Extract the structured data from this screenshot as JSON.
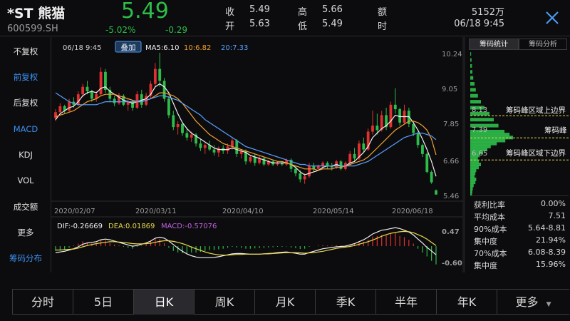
{
  "header": {
    "name": "*ST 熊猫",
    "code": "600599.SH",
    "price": "5.49",
    "change_pct": "-5.02%",
    "change_abs": "-0.29",
    "quote": [
      {
        "label": "收",
        "value": "5.49"
      },
      {
        "label": "开",
        "value": "5.63"
      },
      {
        "label": "高",
        "value": "5.66"
      },
      {
        "label": "低",
        "value": "5.49"
      },
      {
        "label": "额",
        "value": "5152万"
      },
      {
        "label": "时",
        "value": "06/18 9:45"
      }
    ]
  },
  "sidebar": {
    "items": [
      {
        "label": "不复权",
        "blue": false
      },
      {
        "label": "前复权",
        "blue": true
      },
      {
        "label": "后复权",
        "blue": false
      },
      {
        "label": "MACD",
        "blue": true
      },
      {
        "label": "KDJ",
        "blue": false
      },
      {
        "label": "VOL",
        "blue": false
      },
      {
        "label": "成交额",
        "blue": false
      },
      {
        "label": "更多",
        "blue": false
      },
      {
        "label": "筹码分布",
        "blue": true
      }
    ]
  },
  "kline": {
    "timestamp": "06/18 9:45",
    "overlay_button": "叠加",
    "ma_labels": [
      {
        "text": "MA5:6.10",
        "color": "#f0f0f0"
      },
      {
        "text": "10:6.82",
        "color": "#f0a030"
      },
      {
        "text": "20:7.33",
        "color": "#5aa0ff"
      }
    ],
    "price_ticks": [
      "10.24",
      "9.05",
      "7.85",
      "6.66",
      "5.46"
    ],
    "date_ticks": [
      "2020/02/07",
      "2020/03/11",
      "2020/04/10",
      "2020/05/14",
      "2020/06/18"
    ],
    "macd_legend": [
      {
        "text": "DIF:-0.26669",
        "color": "#f0f0f0"
      },
      {
        "text": "DEA:0.01869",
        "color": "#e8d84a"
      },
      {
        "text": "MACD:-0.57076",
        "color": "#c060e0"
      }
    ],
    "macd_ticks": [
      "0.47",
      "-0.60"
    ],
    "up_color": "#e03030",
    "down_color": "#2dbd4a"
  },
  "chip": {
    "tabs": [
      "筹码统计",
      "筹码分析"
    ],
    "levels": [
      {
        "price": "8.13",
        "label": "筹码峰区域上边界"
      },
      {
        "price": "7.39",
        "label": "筹码峰"
      },
      {
        "price": "6.65",
        "label": "筹码峰区域下边界"
      }
    ],
    "stats": [
      {
        "label": "获利比率",
        "value": "0.00%"
      },
      {
        "label": "平均成本",
        "value": "7.51"
      },
      {
        "label": "90%成本",
        "value": "5.64-8.81"
      },
      {
        "label": "集中度",
        "value": "21.94%"
      },
      {
        "label": "70%成本",
        "value": "6.08-8.39"
      },
      {
        "label": "集中度",
        "value": "15.96%"
      }
    ]
  },
  "periods": {
    "tabs": [
      "分时",
      "5日",
      "日K",
      "周K",
      "月K",
      "季K",
      "半年",
      "年K",
      "更多"
    ],
    "active": 2
  },
  "chart_data": {
    "type": "candlestick",
    "candles": [
      [
        8.05,
        8.35,
        7.95,
        8.25
      ],
      [
        8.25,
        8.55,
        8.15,
        8.45
      ],
      [
        8.45,
        8.5,
        8.2,
        8.3
      ],
      [
        8.3,
        8.7,
        8.25,
        8.6
      ],
      [
        8.6,
        8.75,
        8.4,
        8.5
      ],
      [
        8.5,
        8.95,
        8.45,
        8.85
      ],
      [
        8.85,
        9.2,
        8.75,
        9.1
      ],
      [
        9.1,
        9.3,
        8.85,
        8.95
      ],
      [
        8.95,
        9.0,
        8.6,
        8.7
      ],
      [
        8.7,
        8.95,
        8.6,
        8.85
      ],
      [
        8.85,
        9.75,
        8.8,
        9.6
      ],
      [
        9.6,
        9.7,
        8.9,
        9.0
      ],
      [
        9.0,
        9.1,
        8.6,
        8.7
      ],
      [
        8.7,
        8.8,
        8.45,
        8.55
      ],
      [
        8.55,
        8.9,
        8.5,
        8.8
      ],
      [
        8.8,
        8.85,
        8.45,
        8.5
      ],
      [
        8.5,
        8.7,
        8.3,
        8.6
      ],
      [
        8.6,
        8.65,
        8.3,
        8.4
      ],
      [
        8.4,
        8.95,
        8.35,
        8.85
      ],
      [
        8.85,
        9.0,
        8.4,
        8.5
      ],
      [
        8.5,
        8.9,
        8.45,
        8.8
      ],
      [
        8.8,
        9.3,
        8.7,
        9.2
      ],
      [
        9.2,
        9.9,
        9.1,
        9.7
      ],
      [
        9.7,
        10.24,
        9.1,
        9.3
      ],
      [
        9.3,
        9.4,
        8.6,
        8.7
      ],
      [
        8.7,
        8.8,
        8.05,
        8.15
      ],
      [
        8.15,
        8.3,
        7.65,
        7.75
      ],
      [
        7.75,
        7.95,
        7.5,
        7.85
      ],
      [
        7.85,
        7.9,
        7.45,
        7.55
      ],
      [
        7.55,
        7.7,
        7.3,
        7.4
      ],
      [
        7.4,
        7.6,
        7.25,
        7.5
      ],
      [
        7.5,
        7.55,
        7.1,
        7.2
      ],
      [
        7.2,
        7.35,
        6.95,
        7.05
      ],
      [
        7.05,
        7.2,
        6.85,
        7.15
      ],
      [
        7.15,
        7.3,
        6.95,
        7.0
      ],
      [
        7.0,
        7.15,
        6.8,
        6.9
      ],
      [
        6.9,
        7.1,
        6.75,
        7.05
      ],
      [
        7.05,
        7.15,
        6.85,
        6.95
      ],
      [
        6.95,
        7.2,
        6.85,
        7.1
      ],
      [
        7.1,
        7.4,
        7.0,
        7.3
      ],
      [
        7.3,
        7.35,
        6.75,
        6.85
      ],
      [
        6.85,
        7.0,
        6.7,
        6.95
      ],
      [
        6.95,
        7.0,
        6.5,
        6.6
      ],
      [
        6.6,
        6.8,
        6.55,
        6.75
      ],
      [
        6.75,
        6.85,
        6.45,
        6.55
      ],
      [
        6.55,
        6.8,
        6.5,
        6.7
      ],
      [
        6.7,
        6.75,
        6.45,
        6.5
      ],
      [
        6.5,
        6.65,
        6.45,
        6.6
      ],
      [
        6.6,
        6.65,
        6.45,
        6.5
      ],
      [
        6.5,
        6.6,
        6.45,
        6.55
      ],
      [
        6.55,
        6.6,
        6.45,
        6.5
      ],
      [
        6.5,
        6.7,
        6.45,
        6.65
      ],
      [
        6.65,
        6.7,
        6.25,
        6.35
      ],
      [
        6.35,
        6.45,
        6.1,
        6.2
      ],
      [
        6.2,
        6.3,
        5.9,
        6.0
      ],
      [
        6.0,
        6.2,
        5.85,
        6.1
      ],
      [
        6.1,
        6.55,
        6.05,
        6.45
      ],
      [
        6.45,
        6.55,
        6.25,
        6.35
      ],
      [
        6.35,
        6.5,
        6.3,
        6.45
      ],
      [
        6.45,
        6.6,
        6.35,
        6.55
      ],
      [
        6.55,
        6.6,
        6.35,
        6.45
      ],
      [
        6.45,
        6.55,
        6.3,
        6.4
      ],
      [
        6.4,
        6.65,
        6.35,
        6.6
      ],
      [
        6.6,
        6.65,
        6.3,
        6.35
      ],
      [
        6.35,
        6.6,
        6.3,
        6.55
      ],
      [
        6.55,
        6.95,
        6.45,
        6.85
      ],
      [
        6.85,
        7.05,
        6.6,
        6.7
      ],
      [
        6.7,
        7.3,
        6.65,
        7.2
      ],
      [
        7.2,
        7.4,
        6.9,
        7.0
      ],
      [
        7.0,
        7.7,
        6.95,
        7.6
      ],
      [
        7.6,
        8.3,
        7.5,
        7.8
      ],
      [
        7.8,
        8.2,
        7.5,
        7.65
      ],
      [
        7.65,
        8.3,
        7.6,
        8.15
      ],
      [
        8.15,
        8.4,
        7.65,
        7.75
      ],
      [
        7.75,
        8.6,
        7.7,
        8.5
      ],
      [
        8.5,
        9.05,
        8.2,
        8.35
      ],
      [
        8.35,
        8.4,
        7.8,
        7.9
      ],
      [
        7.9,
        8.5,
        7.85,
        8.3
      ],
      [
        8.3,
        8.4,
        7.75,
        7.85
      ],
      [
        7.85,
        7.95,
        7.45,
        7.55
      ],
      [
        7.55,
        7.6,
        7.05,
        7.15
      ],
      [
        7.15,
        7.2,
        6.75,
        6.85
      ],
      [
        6.85,
        6.9,
        6.2,
        6.25
      ],
      [
        6.25,
        6.3,
        5.85,
        5.9
      ],
      [
        5.63,
        5.66,
        5.49,
        5.49
      ]
    ],
    "ma": {
      "MA5": [
        8.0,
        8.2,
        8.3,
        8.4,
        8.45,
        8.6,
        8.8,
        8.9,
        8.95,
        8.9,
        9.05,
        9.1,
        8.95,
        8.85,
        8.75,
        8.65,
        8.6,
        8.55,
        8.6,
        8.65,
        8.7,
        8.85,
        9.1,
        9.2,
        9.1,
        8.9,
        8.55,
        8.2,
        7.9,
        7.7,
        7.55,
        7.45,
        7.35,
        7.25,
        7.15,
        7.05,
        7.0,
        7.0,
        7.0,
        7.05,
        7.0,
        6.95,
        6.9,
        6.8,
        6.75,
        6.7,
        6.65,
        6.6,
        6.55,
        6.55,
        6.55,
        6.55,
        6.5,
        6.4,
        6.25,
        6.15,
        6.2,
        6.25,
        6.3,
        6.4,
        6.45,
        6.45,
        6.5,
        6.45,
        6.45,
        6.55,
        6.6,
        6.75,
        6.9,
        7.1,
        7.4,
        7.55,
        7.7,
        7.8,
        7.95,
        8.15,
        8.1,
        8.1,
        8.1,
        7.9,
        7.65,
        7.35,
        7.0,
        6.6,
        6.1
      ],
      "MA10": [
        8.1,
        8.15,
        8.2,
        8.25,
        8.3,
        8.4,
        8.5,
        8.6,
        8.65,
        8.7,
        8.8,
        8.85,
        8.85,
        8.85,
        8.8,
        8.75,
        8.7,
        8.65,
        8.6,
        8.6,
        8.65,
        8.7,
        8.8,
        8.9,
        8.9,
        8.85,
        8.8,
        8.7,
        8.55,
        8.35,
        8.15,
        7.95,
        7.8,
        7.65,
        7.5,
        7.4,
        7.3,
        7.2,
        7.15,
        7.1,
        7.05,
        7.0,
        6.95,
        6.9,
        6.85,
        6.8,
        6.75,
        6.7,
        6.65,
        6.6,
        6.6,
        6.55,
        6.5,
        6.45,
        6.4,
        6.35,
        6.35,
        6.35,
        6.3,
        6.35,
        6.35,
        6.35,
        6.4,
        6.4,
        6.45,
        6.5,
        6.55,
        6.6,
        6.65,
        6.75,
        6.9,
        7.05,
        7.2,
        7.35,
        7.5,
        7.65,
        7.75,
        7.85,
        7.95,
        7.95,
        7.9,
        7.8,
        7.65,
        7.35,
        6.82
      ],
      "MA20": [
        8.9,
        8.8,
        8.7,
        8.6,
        8.55,
        8.5,
        8.5,
        8.5,
        8.5,
        8.5,
        8.55,
        8.6,
        8.6,
        8.6,
        8.6,
        8.6,
        8.6,
        8.6,
        8.6,
        8.6,
        8.65,
        8.7,
        8.75,
        8.8,
        8.8,
        8.75,
        8.7,
        8.65,
        8.55,
        8.45,
        8.35,
        8.25,
        8.15,
        8.0,
        7.9,
        7.8,
        7.7,
        7.6,
        7.5,
        7.4,
        7.3,
        7.2,
        7.1,
        7.05,
        7.0,
        6.95,
        6.9,
        6.85,
        6.8,
        6.75,
        6.7,
        6.65,
        6.6,
        6.55,
        6.5,
        6.5,
        6.45,
        6.45,
        6.45,
        6.45,
        6.45,
        6.45,
        6.45,
        6.45,
        6.45,
        6.45,
        6.45,
        6.5,
        6.55,
        6.6,
        6.7,
        6.8,
        6.9,
        7.0,
        7.1,
        7.2,
        7.3,
        7.4,
        7.45,
        7.5,
        7.55,
        7.55,
        7.5,
        7.45,
        7.33
      ]
    },
    "macd": {
      "hist": [
        -0.15,
        -0.12,
        -0.1,
        -0.05,
        0.02,
        0.08,
        0.15,
        0.12,
        0.08,
        0.1,
        0.2,
        0.18,
        0.1,
        0.05,
        0.02,
        -0.02,
        -0.05,
        -0.08,
        -0.02,
        0.02,
        0.08,
        0.15,
        0.25,
        0.22,
        0.1,
        -0.05,
        -0.15,
        -0.2,
        -0.22,
        -0.22,
        -0.2,
        -0.2,
        -0.18,
        -0.15,
        -0.12,
        -0.12,
        -0.1,
        -0.08,
        -0.05,
        -0.02,
        -0.04,
        -0.05,
        -0.08,
        -0.08,
        -0.07,
        -0.06,
        -0.05,
        -0.04,
        -0.03,
        -0.02,
        -0.02,
        -0.01,
        -0.04,
        -0.06,
        -0.09,
        -0.08,
        -0.02,
        0.0,
        0.02,
        0.03,
        0.02,
        0.02,
        0.03,
        0.02,
        0.03,
        0.06,
        0.08,
        0.12,
        0.14,
        0.2,
        0.3,
        0.32,
        0.35,
        0.34,
        0.38,
        0.42,
        0.32,
        0.28,
        0.2,
        0.08,
        -0.08,
        -0.2,
        -0.32,
        -0.46,
        -0.57
      ],
      "dif": [
        -0.2,
        -0.18,
        -0.16,
        -0.12,
        -0.08,
        -0.02,
        0.06,
        0.1,
        0.12,
        0.14,
        0.2,
        0.22,
        0.2,
        0.16,
        0.12,
        0.08,
        0.04,
        0.0,
        0.02,
        0.06,
        0.1,
        0.16,
        0.25,
        0.28,
        0.25,
        0.16,
        0.05,
        -0.06,
        -0.16,
        -0.24,
        -0.3,
        -0.34,
        -0.36,
        -0.36,
        -0.36,
        -0.35,
        -0.33,
        -0.3,
        -0.27,
        -0.24,
        -0.23,
        -0.23,
        -0.24,
        -0.25,
        -0.25,
        -0.25,
        -0.24,
        -0.23,
        -0.22,
        -0.2,
        -0.19,
        -0.18,
        -0.2,
        -0.22,
        -0.25,
        -0.25,
        -0.2,
        -0.16,
        -0.12,
        -0.08,
        -0.06,
        -0.04,
        -0.02,
        -0.01,
        0.0,
        0.04,
        0.08,
        0.14,
        0.2,
        0.28,
        0.38,
        0.44,
        0.5,
        0.52,
        0.55,
        0.58,
        0.55,
        0.5,
        0.44,
        0.35,
        0.22,
        0.1,
        -0.04,
        -0.15,
        -0.27
      ],
      "dea": [
        -0.12,
        -0.12,
        -0.11,
        -0.1,
        -0.09,
        -0.06,
        -0.02,
        0.02,
        0.05,
        0.08,
        0.1,
        0.12,
        0.14,
        0.14,
        0.13,
        0.12,
        0.1,
        0.08,
        0.07,
        0.07,
        0.08,
        0.09,
        0.12,
        0.15,
        0.17,
        0.17,
        0.15,
        0.12,
        0.08,
        0.03,
        -0.03,
        -0.08,
        -0.13,
        -0.18,
        -0.22,
        -0.25,
        -0.27,
        -0.28,
        -0.28,
        -0.27,
        -0.26,
        -0.26,
        -0.25,
        -0.25,
        -0.25,
        -0.25,
        -0.24,
        -0.24,
        -0.23,
        -0.22,
        -0.21,
        -0.2,
        -0.2,
        -0.2,
        -0.21,
        -0.22,
        -0.21,
        -0.2,
        -0.18,
        -0.16,
        -0.13,
        -0.1,
        -0.07,
        -0.05,
        -0.03,
        -0.01,
        0.02,
        0.06,
        0.1,
        0.14,
        0.19,
        0.25,
        0.31,
        0.36,
        0.4,
        0.43,
        0.45,
        0.46,
        0.45,
        0.42,
        0.36,
        0.3,
        0.22,
        0.12,
        0.02
      ]
    },
    "price_range": [
      5.46,
      10.24
    ],
    "macd_range": [
      -0.6,
      0.47
    ],
    "chip_distribution": [
      [
        10.2,
        0.02
      ],
      [
        10.0,
        0.03
      ],
      [
        9.8,
        0.04
      ],
      [
        9.6,
        0.05
      ],
      [
        9.4,
        0.07
      ],
      [
        9.2,
        0.1
      ],
      [
        9.0,
        0.13
      ],
      [
        8.8,
        0.18
      ],
      [
        8.6,
        0.25
      ],
      [
        8.4,
        0.33
      ],
      [
        8.2,
        0.45
      ],
      [
        8.0,
        0.55
      ],
      [
        7.8,
        0.66
      ],
      [
        7.6,
        0.8
      ],
      [
        7.5,
        0.92
      ],
      [
        7.4,
        1.0
      ],
      [
        7.3,
        0.82
      ],
      [
        7.2,
        0.62
      ],
      [
        7.1,
        0.48
      ],
      [
        7.0,
        0.4
      ],
      [
        6.9,
        0.3
      ],
      [
        6.8,
        0.22
      ],
      [
        6.7,
        0.18
      ],
      [
        6.6,
        0.2
      ],
      [
        6.5,
        0.25
      ],
      [
        6.4,
        0.2
      ],
      [
        6.3,
        0.14
      ],
      [
        6.2,
        0.12
      ],
      [
        6.1,
        0.1
      ],
      [
        6.0,
        0.14
      ],
      [
        5.9,
        0.12
      ],
      [
        5.8,
        0.08
      ],
      [
        5.7,
        0.06
      ],
      [
        5.6,
        0.05
      ],
      [
        5.5,
        0.04
      ]
    ]
  }
}
